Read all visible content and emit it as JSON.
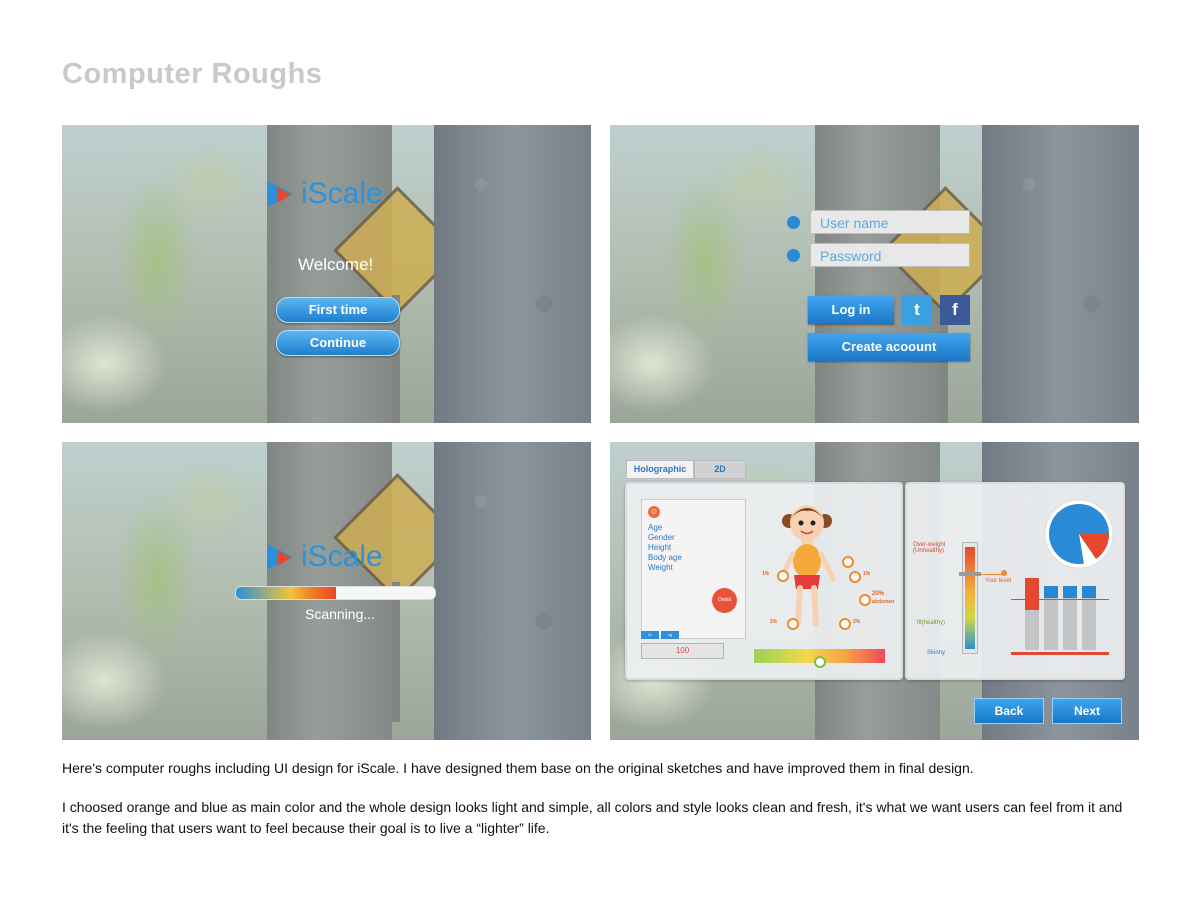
{
  "title": "Computer Roughs",
  "panel1": {
    "logo_text": "iScale",
    "welcome": "Welcome!",
    "first_time_label": "First time",
    "continue_label": "Continue"
  },
  "panel2": {
    "username_placeholder": "User name",
    "password_placeholder": "Password",
    "login_label": "Log in",
    "create_account_label": "Create acoount",
    "twitter_glyph": "t",
    "facebook_glyph": "f"
  },
  "panel3": {
    "logo_text": "iScale",
    "scanning_text": "Scanning...",
    "progress": 0.5
  },
  "panel4": {
    "tabs": [
      "Holographic",
      "2D"
    ],
    "profile_fields": [
      "Age",
      "Gender",
      "Height",
      "Body age",
      "Weight"
    ],
    "detail_label": "Detail",
    "units": [
      "lb",
      "kg"
    ],
    "ruler_value": "100",
    "body_labels": [
      "1%",
      "1%",
      "20%",
      "abdomen",
      "2%",
      "2%"
    ],
    "scale_labels": [
      "Over-weight (Unhealthy)",
      "Your level",
      "fit(healthy)",
      "Skinny"
    ],
    "bar_levels": [
      0.9,
      0.8,
      0.8,
      0.8
    ],
    "back_label": "Back",
    "next_label": "Next"
  },
  "captions": {
    "first": "Here's computer roughs including UI design for iScale. I have designed them base on the original sketches and have improved them in final design.",
    "second": "I choosed orange and blue as main color and the whole design looks light and simple, all colors and style looks clean and fresh, it's what we want users can feel from it and it's the feeling that users want to feel because their goal is to live a “lighter” life."
  },
  "colors": {
    "accent_blue": "#2b93de",
    "accent_orange": "#e5472f"
  }
}
